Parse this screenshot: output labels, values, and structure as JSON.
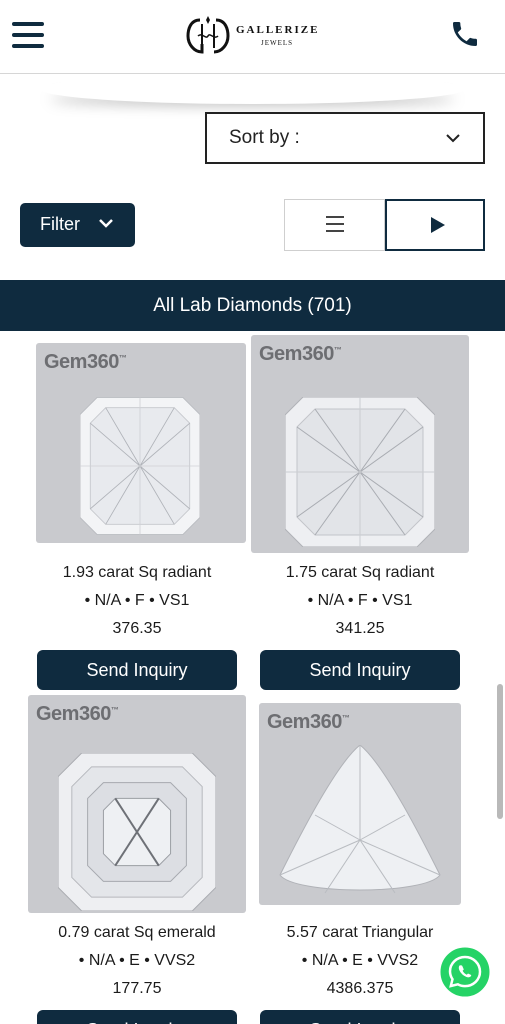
{
  "header": {
    "logo_name": "GALLERIZE",
    "logo_sub": "JEWELS",
    "menu_icon": "hamburger-menu-icon",
    "phone_icon": "phone-icon"
  },
  "sort": {
    "label": "Sort by :"
  },
  "filter": {
    "label": "Filter"
  },
  "banner": {
    "title": "All Lab Diamonds (701)"
  },
  "products": [
    {
      "brand": "Gem360",
      "tm": "™",
      "title": "1.93 carat Sq radiant",
      "specs": "• N/A • F • VS1",
      "price": "376.35",
      "button": "Send Inquiry",
      "shape": "radiant"
    },
    {
      "brand": "Gem360",
      "tm": "™",
      "title": "1.75 carat Sq radiant",
      "specs": "• N/A • F • VS1",
      "price": "341.25",
      "button": "Send Inquiry",
      "shape": "radiant"
    },
    {
      "brand": "Gem360",
      "tm": "™",
      "title": "0.79 carat Sq emerald",
      "specs": "• N/A • E • VVS2",
      "price": "177.75",
      "button": "Send Inquiry",
      "shape": "emerald"
    },
    {
      "brand": "Gem360",
      "tm": "™",
      "title": "5.57 carat Triangular",
      "specs": "• N/A • E • VVS2",
      "price": "4386.375",
      "button": "Send Inquiry",
      "shape": "triangle"
    }
  ],
  "colors": {
    "navy": "#0f2b3f",
    "card_bg": "#c9cace",
    "whatsapp": "#25d366"
  }
}
